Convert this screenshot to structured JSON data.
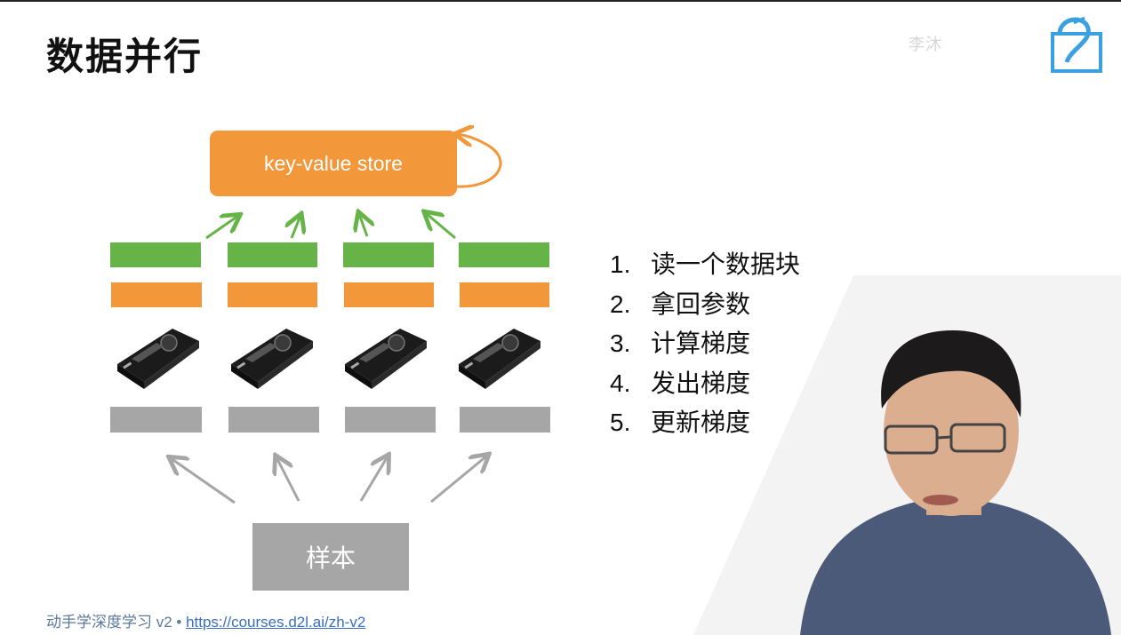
{
  "slide": {
    "title": "数据并行",
    "kv_store_label": "key-value store",
    "sample_label": "样本",
    "steps": [
      {
        "num": "1.",
        "text": "读一个数据块"
      },
      {
        "num": "2.",
        "text": "拿回参数"
      },
      {
        "num": "3.",
        "text": "计算梯度"
      },
      {
        "num": "4.",
        "text": "发出梯度"
      },
      {
        "num": "5.",
        "text": "更新梯度"
      }
    ],
    "footer_text": "动手学深度学习 v2 • ",
    "footer_link": "https://courses.d2l.ai/zh-v2"
  },
  "overlay": {
    "watermark": "李沐",
    "logo": "bilibili-logo"
  },
  "colors": {
    "green": "#66b447",
    "orange": "#f2973a",
    "gray": "#a6a6a6",
    "arrow_green": "#66b447",
    "arrow_gray": "#a6a6a6",
    "link": "#3a6ec2"
  },
  "icons": {
    "gpu": "gpu-card-icon"
  }
}
